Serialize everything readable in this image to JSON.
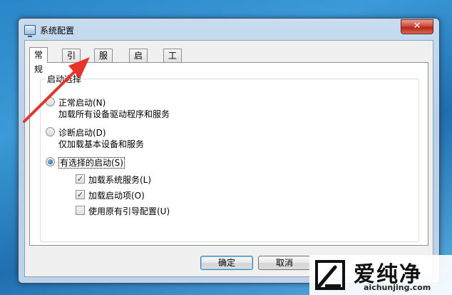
{
  "window": {
    "title": "系统配置",
    "close_glyph": "✕"
  },
  "tabs": [
    {
      "label": "常规",
      "active": true
    },
    {
      "label": "引导",
      "active": false
    },
    {
      "label": "服务",
      "active": false
    },
    {
      "label": "启动",
      "active": false
    },
    {
      "label": "工具",
      "active": false
    }
  ],
  "startup_group": {
    "label": "启动选择",
    "options": [
      {
        "label": "正常启动(N)",
        "description": "加载所有设备驱动程序和服务",
        "selected": false
      },
      {
        "label": "诊断启动(D)",
        "description": "仅加载基本设备和服务",
        "selected": false
      },
      {
        "label": "有选择的启动(S)",
        "selected": true
      }
    ],
    "checkboxes": [
      {
        "label": "加载系统服务(L)",
        "checked": true
      },
      {
        "label": "加载启动项(O)",
        "checked": true
      },
      {
        "label": "使用原有引导配置(U)",
        "checked": false
      }
    ]
  },
  "buttons": {
    "ok": "确定",
    "cancel": "取消"
  },
  "watermark": {
    "brand": "爱纯净",
    "url": "aichunjing.com"
  },
  "colors": {
    "annotation_arrow": "#e8332a",
    "close_button": "#c7402f"
  }
}
